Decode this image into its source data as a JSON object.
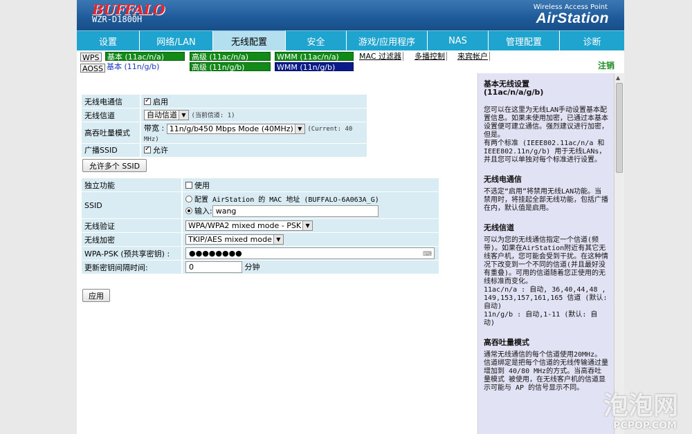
{
  "header": {
    "brand": "BUFFALO",
    "model": "WZR-D1800H",
    "product_line": "Wireless Access Point",
    "product_name": "AirStation"
  },
  "nav": {
    "tabs": [
      {
        "label": "设置",
        "active": false
      },
      {
        "label": "网络/LAN",
        "active": false
      },
      {
        "label": "无线配置",
        "active": true
      },
      {
        "label": "安全",
        "active": false
      },
      {
        "label": "游戏/应用程序",
        "active": false
      },
      {
        "label": "NAS",
        "active": false
      },
      {
        "label": "管理配置",
        "active": false
      },
      {
        "label": "诊断",
        "active": false
      }
    ]
  },
  "subnav": {
    "wps": "WPS",
    "aoss": "AOSS",
    "basic_ac": "基本 (11ac/n/a)",
    "basic_bgn": "基本 (11n/g/b)",
    "adv_ac": "高级 (11ac/n/a)",
    "adv_bgn": "高级 (11n/g/b)",
    "wmm_ac": "WMM (11ac/n/a)",
    "wmm_bgn": "WMM (11n/g/b)",
    "mac_filter": "MAC 过滤器",
    "multicast": "多播控制",
    "guest": "来宾帐户",
    "logout": "注销"
  },
  "form1": {
    "radio_label": "无线电通信",
    "radio_value": "启用",
    "channel_label": "无线信道",
    "channel_value": "自动信道",
    "channel_current": "(当前信道: 1)",
    "throughput_label": "高吞吐量模式",
    "bandwidth_label": "带宽 :",
    "bandwidth_value": "11n/g/b450 Mbps Mode (40MHz)",
    "bandwidth_current": "(Current: 40 MHz)",
    "ssid_broadcast_label": "广播SSID",
    "ssid_broadcast_value": "允许",
    "multi_ssid_button": "允许多个 SSID"
  },
  "form2": {
    "isolation_label": "独立功能",
    "isolation_value": "使用",
    "ssid_label": "SSID",
    "ssid_opt1": "配置 AirStation 的 MAC 地址 (BUFFALO-6A063A_G)",
    "ssid_opt2": "输入:",
    "ssid_input": "wang",
    "auth_label": "无线验证",
    "auth_value": "WPA/WPA2 mixed mode - PSK",
    "encrypt_label": "无线加密",
    "encrypt_value": "TKIP/AES mixed mode",
    "psk_label": "WPA-PSK (预共享密钥) :",
    "psk_value": "●●●●●●●●",
    "rekey_label": "更新密钥间隔时间:",
    "rekey_value": "0",
    "rekey_unit": "分钟",
    "apply_button": "应用"
  },
  "help": {
    "t1": "基本无线设置",
    "t1b": "(11ac/n/a/g/b)",
    "p1": "您可以在这里为无线LAN手动设置基本配置信息。如果未使用加密，已通过本基本设置便可建立通信。强烈建议进行加密，但是。",
    "p1b": "有两个标准 (IEEE802.11ac/n/a 和 IEEE802.11n/g/b) 用于无线LANs，并且您可以单独对每个标准进行设置。",
    "t2": "无线电通信",
    "p2": "不选定“启用”将禁用无线LAN功能。当禁用时，将挂起全部无线功能，包括广播在内，默认值是启用。",
    "t3": "无线信道",
    "p3": "可以为您的无线通信指定一个信道(频带)。如果在AirStation附近有其它无线客户机，您可能会受到干扰。在这种情况下改变到一个不同的信道(并且最好没有重叠)。可用的信道随着您正使用的无线标准而变化。",
    "p3b": "11ac/n/a : 自动, 36,40,44,48 , 149,153,157,161,165 信道 (默认: 自动)",
    "p3c": "11n/g/b : 自动,1-11 (默认: 自动)",
    "t4": "高吞吐量模式",
    "p4": "通常无线通信的每个信道使用20MHz。",
    "p4b": "信道绑定是把每个信道的无线传输通过量增加到 40/80 MHz的方式。当高吞吐量模式 被使用，在无线客户机的信道显示可能与 AP 的信号显示不同。"
  },
  "watermark": {
    "big": "泡泡网",
    "small": "PCPOP.COM"
  }
}
